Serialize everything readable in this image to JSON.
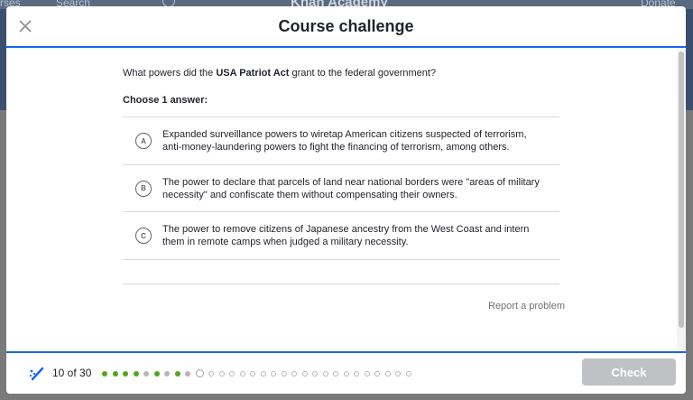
{
  "background": {
    "courses_label": "rses",
    "search_label": "Search",
    "logo_label": "Khan Academy",
    "donate_label": "Donate"
  },
  "modal": {
    "title": "Course challenge",
    "question_prefix": "What powers did the ",
    "question_bold": "USA Patriot Act",
    "question_suffix": " grant to the federal government?",
    "instruction": "Choose 1 answer:",
    "choices": [
      {
        "letter": "A",
        "text": "Expanded surveillance powers to wiretap American citizens suspected of terrorism, anti-money-laundering powers to fight the financing of terrorism, among others."
      },
      {
        "letter": "B",
        "text": "The power to declare that parcels of land near national borders were \"areas of military necessity\" and confiscate them without compensating their owners."
      },
      {
        "letter": "C",
        "text": "The power to remove citizens of Japanese ancestry from the West Coast and intern them in remote camps when judged a military necessity."
      }
    ],
    "report_label": "Report a problem"
  },
  "footer": {
    "progress_label": "10 of 30",
    "dots": [
      "green",
      "green",
      "green",
      "green",
      "gray",
      "green",
      "gray",
      "green",
      "gray",
      "current",
      "empty",
      "empty",
      "empty",
      "empty",
      "empty",
      "empty",
      "empty",
      "empty",
      "empty",
      "empty",
      "empty",
      "empty",
      "empty",
      "empty",
      "empty",
      "empty",
      "empty",
      "empty",
      "empty",
      "empty"
    ],
    "check_label": "Check",
    "icon": "pencil-sparkle-icon"
  },
  "colors": {
    "accent": "#1865f2",
    "correct": "#54a61e",
    "disabled": "#bfc1c4"
  }
}
